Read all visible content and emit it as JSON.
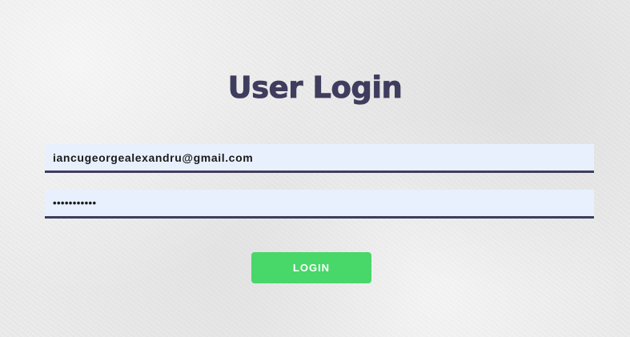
{
  "title": "User Login",
  "email": {
    "value": "iancugeorgealexandru@gmail.com"
  },
  "password": {
    "value": "•••••••••••"
  },
  "login_button": {
    "label": "LOGIN"
  },
  "colors": {
    "title": "#3f3d5e",
    "input_background": "#e8f0fe",
    "input_border": "#3f3d5e",
    "button": "#48d769",
    "button_text": "#ffffff"
  }
}
